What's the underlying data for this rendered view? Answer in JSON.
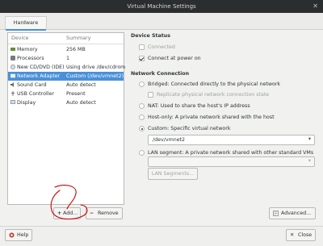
{
  "window": {
    "title": "Virtual Machine Settings",
    "close_glyph": "✕"
  },
  "tabs": [
    {
      "label": "Hardware"
    }
  ],
  "devices": {
    "headers": {
      "device": "Device",
      "summary": "Summary"
    },
    "rows": [
      {
        "icon": "memory-icon",
        "name": "Memory",
        "summary": "256 MB",
        "selected": false
      },
      {
        "icon": "processor-icon",
        "name": "Processors",
        "summary": "1",
        "selected": false
      },
      {
        "icon": "cdrom-icon",
        "name": "New CD/DVD (IDE)",
        "summary": "Using drive /dev/cdrom",
        "selected": false
      },
      {
        "icon": "network-adapter-icon",
        "name": "Network Adapter",
        "summary": "Custom (/dev/vmnet2)",
        "selected": true
      },
      {
        "icon": "sound-card-icon",
        "name": "Sound Card",
        "summary": "Auto detect",
        "selected": false
      },
      {
        "icon": "usb-icon",
        "name": "USB Controller",
        "summary": "Present",
        "selected": false
      },
      {
        "icon": "display-icon",
        "name": "Display",
        "summary": "Auto detect",
        "selected": false
      }
    ],
    "add_label": "Add...",
    "add_glyph": "+",
    "remove_label": "Remove",
    "remove_glyph": "−"
  },
  "device_status": {
    "title": "Device Status",
    "connected": {
      "label": "Connected",
      "checked": false,
      "enabled": false
    },
    "connect_power_on": {
      "label": "Connect at power on",
      "checked": true,
      "enabled": true
    }
  },
  "network_connection": {
    "title": "Network Connection",
    "bridged": {
      "label": "Bridged: Connected directly to the physical network",
      "selected": false
    },
    "replicate": {
      "label": "Replicate physical network connection state",
      "checked": false
    },
    "nat": {
      "label": "NAT: Used to share the host's IP address",
      "selected": false
    },
    "host_only": {
      "label": "Host-only: A private network shared with the host",
      "selected": false
    },
    "custom": {
      "label": "Custom: Specific virtual network",
      "selected": true,
      "value": "/dev/vmnet2"
    },
    "lan": {
      "label": "LAN segment: A private network shared with other standard VMs",
      "selected": false,
      "value": ""
    },
    "lan_segments_label": "LAN Segments...",
    "advanced_label": "Advanced..."
  },
  "footer": {
    "help_label": "Help",
    "close_label": "Close"
  },
  "colors": {
    "selection": "#4a90d9",
    "titlebar": "#2b2e2f",
    "annotation": "#cc0000"
  }
}
